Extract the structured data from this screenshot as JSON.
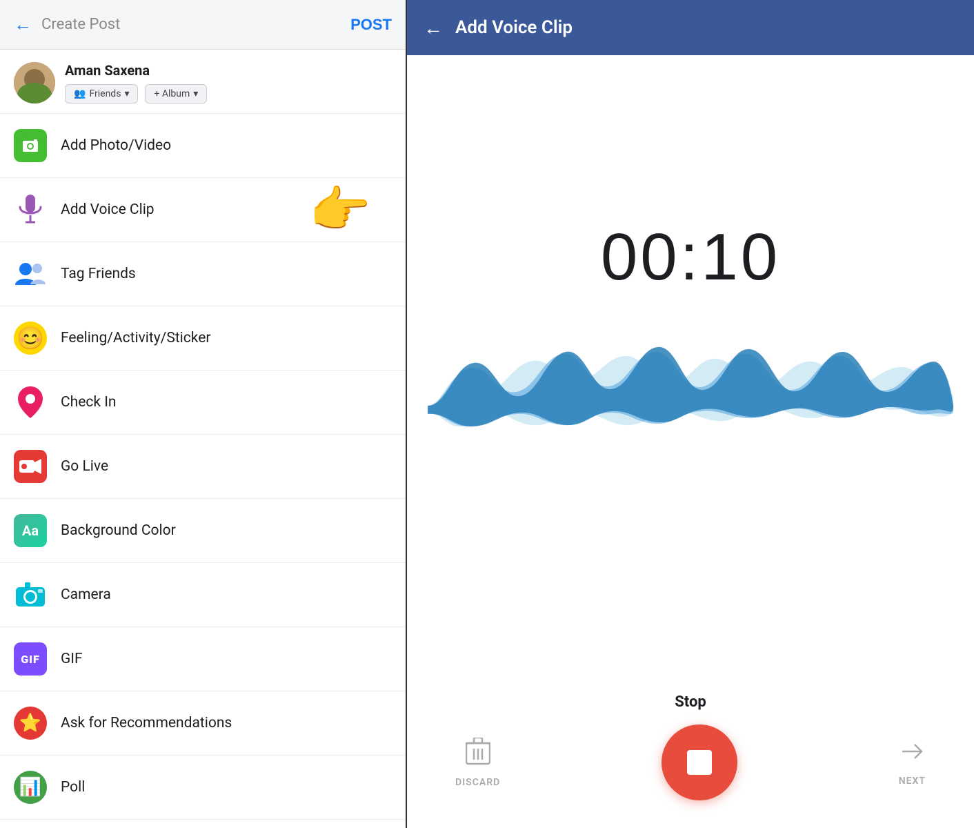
{
  "left": {
    "header": {
      "back_label": "←",
      "title": "Create Post",
      "post_btn": "POST"
    },
    "user": {
      "name": "Aman Saxena",
      "friends_btn": "Friends",
      "album_btn": "+ Album"
    },
    "menu_items": [
      {
        "id": "photo-video",
        "label": "Add Photo/Video",
        "icon": "🖼️",
        "icon_class": "icon-photo"
      },
      {
        "id": "voice-clip",
        "label": "Add Voice Clip",
        "icon": "🎙️",
        "icon_class": "icon-voice",
        "has_pointer": true
      },
      {
        "id": "tag-friends",
        "label": "Tag Friends",
        "icon": "👤",
        "icon_class": "icon-tag"
      },
      {
        "id": "feeling",
        "label": "Feeling/Activity/Sticker",
        "icon": "😊",
        "icon_class": "icon-feeling"
      },
      {
        "id": "check-in",
        "label": "Check In",
        "icon": "📍",
        "icon_class": "icon-checkin"
      },
      {
        "id": "go-live",
        "label": "Go Live",
        "icon": "🔴",
        "icon_class": "icon-golive"
      },
      {
        "id": "background-color",
        "label": "Background Color",
        "icon": "Aa",
        "icon_class": "icon-bgcolor"
      },
      {
        "id": "camera",
        "label": "Camera",
        "icon": "📷",
        "icon_class": "icon-camera"
      },
      {
        "id": "gif",
        "label": "GIF",
        "icon": "GIF",
        "icon_class": "icon-gif"
      },
      {
        "id": "recommend",
        "label": "Ask for Recommendations",
        "icon": "⭐",
        "icon_class": "icon-recommend"
      },
      {
        "id": "poll",
        "label": "Poll",
        "icon": "📊",
        "icon_class": "icon-poll"
      }
    ]
  },
  "right": {
    "header": {
      "back_label": "←",
      "title": "Add Voice Clip"
    },
    "timer": "00:10",
    "stop_label": "Stop",
    "discard_label": "DISCARD",
    "next_label": "NEXT"
  }
}
